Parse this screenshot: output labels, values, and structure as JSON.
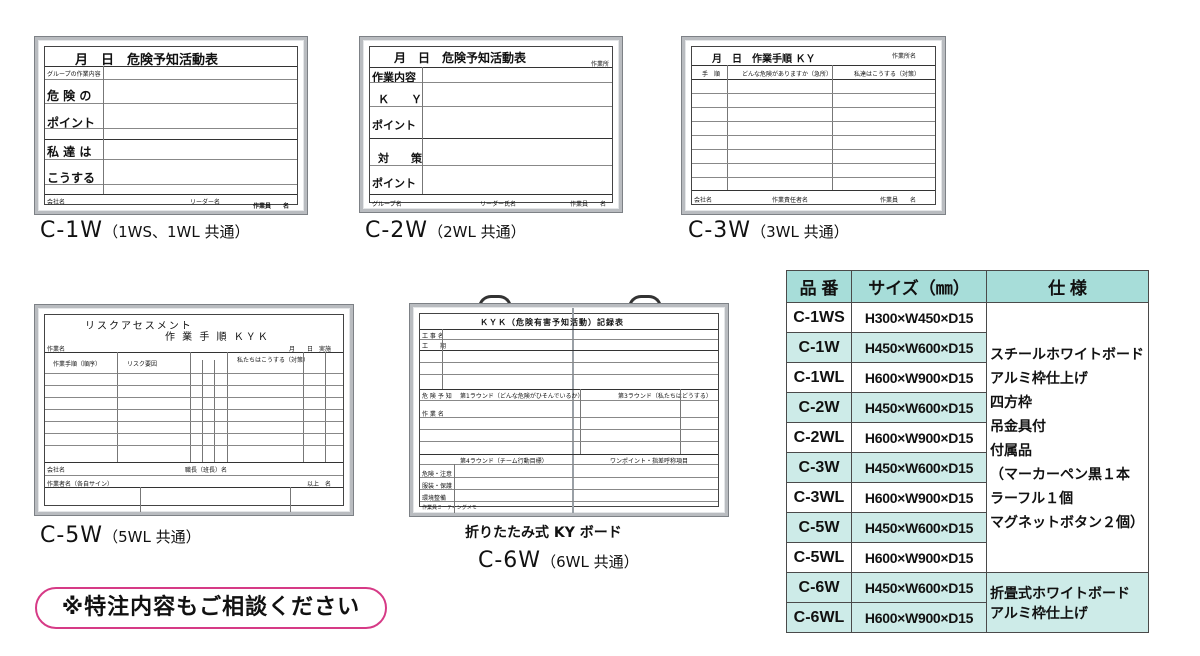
{
  "boards": {
    "c1w": {
      "title": "月　日　危険予知活動表",
      "rows": [
        "グループの作業内容",
        "危 険 の",
        "ポイント",
        "私 達 は",
        "こうする"
      ],
      "footer": {
        "left": "会社名",
        "mid": "リーダー名",
        "right": "作業員　　名"
      },
      "caption": "C-1W",
      "caption_sub": "（1WS、1WL 共通）"
    },
    "c2w": {
      "title": "月　日　危険予知活動表",
      "corner": "作業所",
      "rows": [
        "作業内容",
        "Ｋ　　Ｙ",
        "ポイント",
        "対　　策",
        "ポイント"
      ],
      "footer": {
        "left": "グループ名",
        "mid": "リーダー氏名",
        "right": "作業員　　名"
      },
      "caption": "C-2W",
      "caption_sub": "（2WL 共通）"
    },
    "c3w": {
      "title": "月　日　作業手順 ＫＹ",
      "corner": "作業所名",
      "headers": [
        "手　順",
        "どんな危険がありますか（急所）",
        "私達はこうする（対策）"
      ],
      "footer": {
        "left": "会社名",
        "mid": "作業責任者名",
        "right": "作業員　　名"
      },
      "caption": "C-3W",
      "caption_sub": "（3WL 共通）"
    },
    "c5w": {
      "title1": "リスクアセスメント",
      "title2": "作 業 手 順 ＫＹＫ",
      "date": "月　　日　実施",
      "header_left": "作業名",
      "col1": "作業手順（順序）",
      "col2": "リスク要因",
      "col3": "私たちはこうする（対策）",
      "footer_left": "会社名",
      "footer_mid": "職長（班長）名",
      "footer_sign": "作業者名（各自サイン）",
      "footer_right": "以上　名",
      "caption": "C-5W",
      "caption_sub": "（5WL 共通）"
    },
    "c6w": {
      "title": "ＫＹＫ（危険有害予知活動）記録表",
      "row_labels": [
        "工 事 名",
        "工　　期",
        "危 険 予 知",
        "作 業 名"
      ],
      "round1": "第1ラウンド（どんな危険がひそんでいるか）",
      "round3": "第3ラウンド（私たちはどうする）",
      "round4": "第4ラウンド（チーム行動目標）",
      "point": "ワンポイント・指差呼称項目",
      "bottom_rows": [
        "危険・注意",
        "服装・保護",
        "環境整備",
        "作業員ミーティングメモ"
      ],
      "label": "折りたたみ式 KY ボード",
      "caption": "C-6W",
      "caption_sub": "（6WL 共通）"
    }
  },
  "notice": "※特注内容もご相談ください",
  "spec_table": {
    "headers": [
      "品 番",
      "サイズ（㎜）",
      "仕 様"
    ],
    "rows": [
      {
        "code": "C-1WS",
        "size": "H300×W450×D15"
      },
      {
        "code": "C-1W",
        "size": "H450×W600×D15"
      },
      {
        "code": "C-1WL",
        "size": "H600×W900×D15"
      },
      {
        "code": "C-2W",
        "size": "H450×W600×D15"
      },
      {
        "code": "C-2WL",
        "size": "H600×W900×D15"
      },
      {
        "code": "C-3W",
        "size": "H450×W600×D15"
      },
      {
        "code": "C-3WL",
        "size": "H600×W900×D15"
      },
      {
        "code": "C-5W",
        "size": "H450×W600×D15"
      },
      {
        "code": "C-5WL",
        "size": "H600×W900×D15"
      },
      {
        "code": "C-6W",
        "size": "H450×W600×D15"
      },
      {
        "code": "C-6WL",
        "size": "H600×W900×D15"
      }
    ],
    "spec1": [
      "スチールホワイトボード",
      "アルミ枠仕上げ",
      "四方枠",
      "吊金具付",
      "付属品",
      "（マーカーペン黒１本",
      "ラーフル１個",
      "マグネットボタン２個）"
    ],
    "spec2": [
      "折畳式ホワイトボード",
      "アルミ枠仕上げ"
    ]
  },
  "colors": {
    "table_header": "#a7ddd9",
    "table_tint": "#cdebe8",
    "notice_border": "#d63a86"
  }
}
